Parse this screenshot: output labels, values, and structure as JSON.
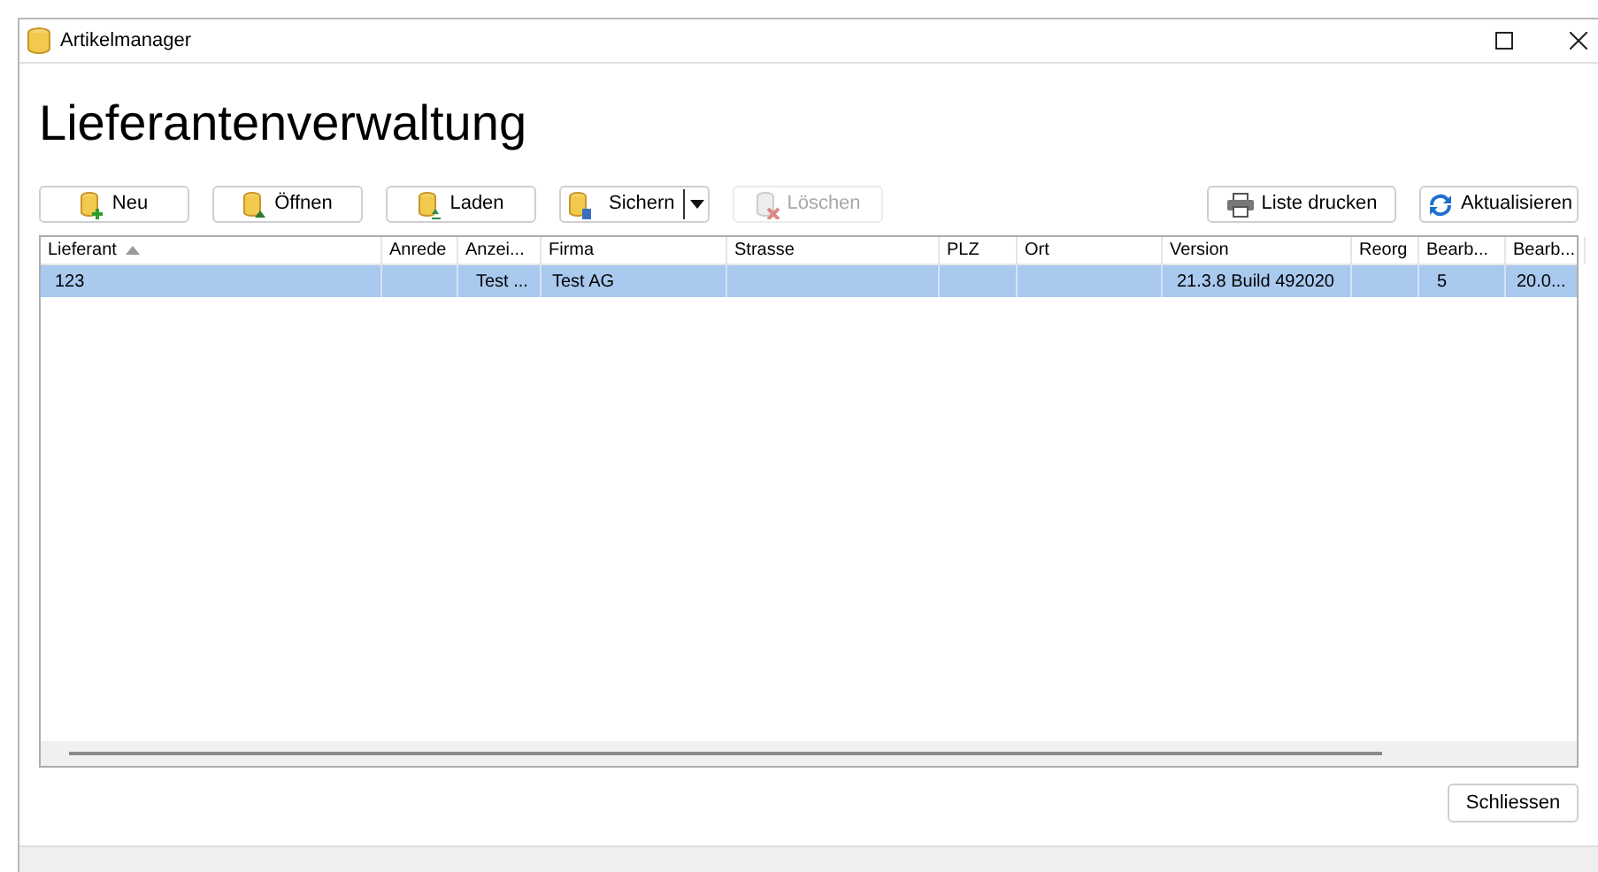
{
  "window": {
    "title": "Artikelmanager"
  },
  "heading": "Lieferantenverwaltung",
  "toolbar": [
    {
      "kind": "new",
      "label": "Neu",
      "disabled": false
    },
    {
      "kind": "open",
      "label": "Öffnen",
      "disabled": false
    },
    {
      "kind": "load",
      "label": "Laden",
      "disabled": false
    },
    {
      "kind": "save",
      "label": "Sichern",
      "disabled": false,
      "split": true
    },
    {
      "kind": "delete",
      "label": "Löschen",
      "disabled": true
    }
  ],
  "toolbar_right": [
    {
      "kind": "print",
      "label": "Liste drucken"
    },
    {
      "kind": "refresh",
      "label": "Aktualisieren"
    }
  ],
  "table": {
    "columns": [
      {
        "label": "Lieferant",
        "sorted": true
      },
      {
        "label": "Anrede",
        "sorted": false
      },
      {
        "label": "Anzei...",
        "sorted": false
      },
      {
        "label": "Firma",
        "sorted": false
      },
      {
        "label": "Strasse",
        "sorted": false
      },
      {
        "label": "PLZ",
        "sorted": false
      },
      {
        "label": "Ort",
        "sorted": false
      },
      {
        "label": "Version",
        "sorted": false
      },
      {
        "label": "Reorg",
        "sorted": false
      },
      {
        "label": "Bearb...",
        "sorted": false
      },
      {
        "label": "Bearb...",
        "sorted": false
      }
    ],
    "rows": [
      {
        "selected": true,
        "cells": [
          "123",
          "",
          "Test ...",
          "Test AG",
          "",
          "",
          "",
          "21.3.8 Build 492020",
          "",
          "5",
          "20.0..."
        ]
      }
    ]
  },
  "close_button": "Schliessen"
}
